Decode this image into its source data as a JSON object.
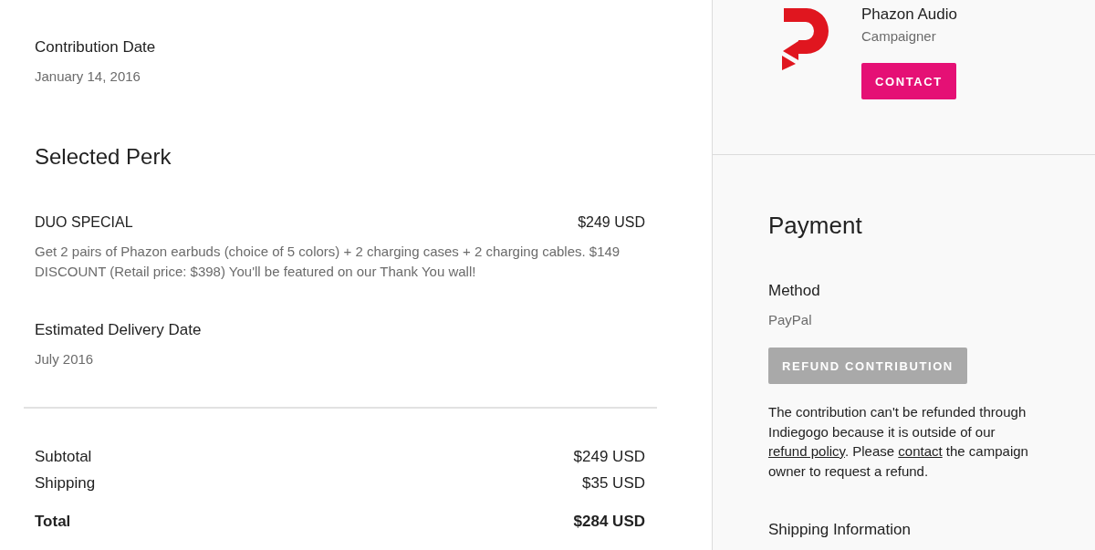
{
  "contribution": {
    "label": "Contribution Date",
    "value": "January 14, 2016"
  },
  "perk": {
    "heading": "Selected Perk",
    "name": "DUO SPECIAL",
    "price": "$249 USD",
    "description": "Get 2 pairs of Phazon earbuds (choice of 5 colors) + 2 charging cases + 2 charging cables. $149 DISCOUNT (Retail price: $398) You'll be featured on our Thank You wall!",
    "delivery": {
      "label": "Estimated Delivery Date",
      "value": "July 2016"
    }
  },
  "summary": [
    {
      "kind": "line",
      "label": "Subtotal",
      "amount": "$249 USD"
    },
    {
      "kind": "line",
      "label": "Shipping",
      "amount": "$35 USD"
    },
    {
      "kind": "total",
      "label": "Total",
      "amount": "$284 USD"
    }
  ],
  "campaigner": {
    "name": "Phazon Audio",
    "role": "Campaigner",
    "contact_button": "CONTACT"
  },
  "payment": {
    "heading": "Payment",
    "method_label": "Method",
    "method": "PayPal",
    "refund_button": {
      "label": "REFUND CONTRIBUTION",
      "disabled": true
    },
    "note": [
      {
        "kind": "text",
        "text": "The contribution can't be refunded through Indiegogo because it is outside of our "
      },
      {
        "kind": "link",
        "text": "refund policy"
      },
      {
        "kind": "text",
        "text": ". Please "
      },
      {
        "kind": "link",
        "text": "contact"
      },
      {
        "kind": "text",
        "text": " the campaign owner to request a refund."
      }
    ]
  },
  "shipping": {
    "heading": "Shipping Information"
  }
}
